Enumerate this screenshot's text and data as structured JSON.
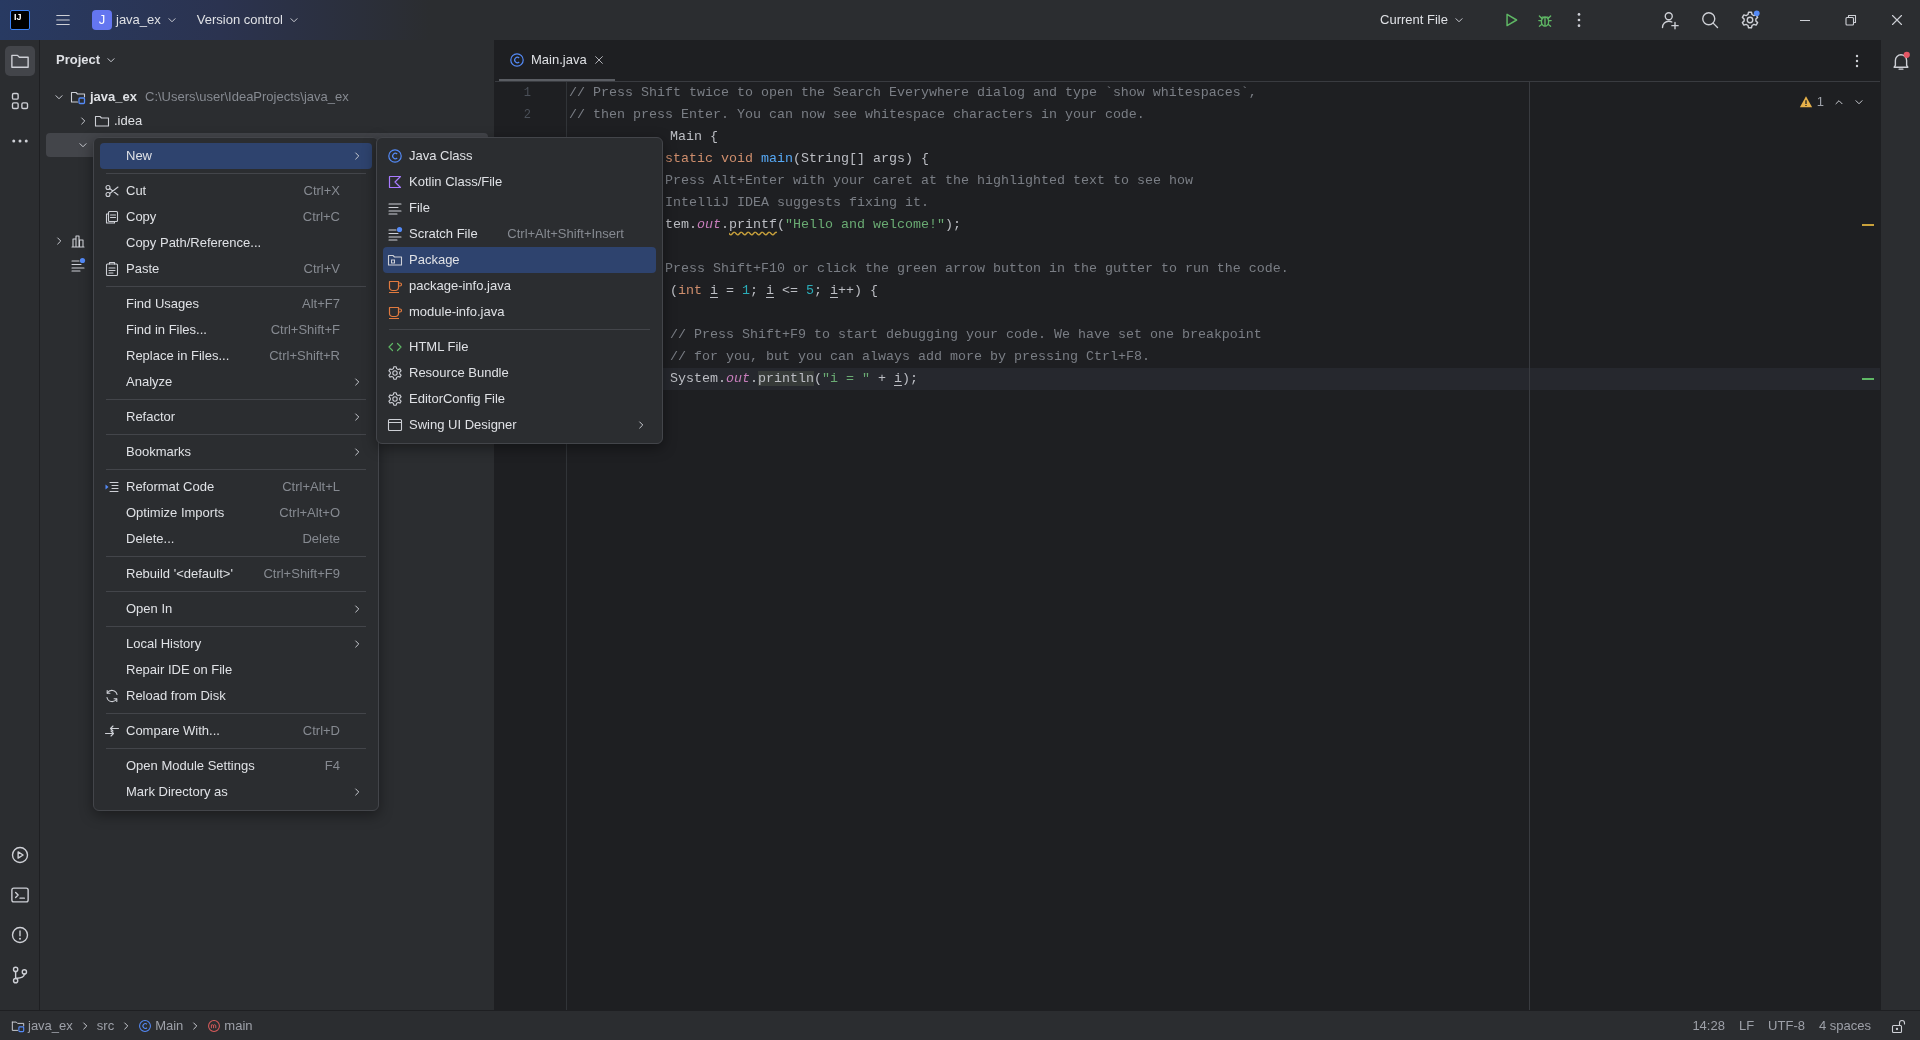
{
  "title_bar": {
    "logo": "IJ",
    "project_badge": "J",
    "project": "java_ex",
    "vcs": "Version control",
    "run_config": "Current File"
  },
  "tool_strip": {
    "top": [
      {
        "selected": true
      },
      {
        "selected": false
      },
      {
        "selected": false
      }
    ],
    "bottom": [
      {
        "selected": false
      },
      {
        "selected": false
      },
      {
        "selected": false
      },
      {
        "selected": false
      }
    ]
  },
  "project": {
    "title": "Project",
    "tree": [
      {
        "label": "java_ex",
        "path": "C:\\Users\\user\\IdeaProjects\\java_ex",
        "kind": "module",
        "expanded": true,
        "selected": false,
        "children": [
          {
            "label": ".idea",
            "kind": "folder",
            "expanded": false,
            "selected": false
          },
          {
            "expanded": true,
            "selected": true
          }
        ]
      },
      {
        "kind": "library",
        "expanded": false,
        "selected": false
      },
      {
        "kind": "scratch",
        "selected": false
      }
    ]
  },
  "tabs": [
    {
      "label": "Main.java",
      "selected": true
    }
  ],
  "editor": {
    "warnings": "1",
    "lines": [
      {
        "kind": "code",
        "number": "1",
        "current": false,
        "tokens": [
          {
            "kind": "comment",
            "text": "// Press Shift twice to open the Search Everywhere dialog and type `show whitespaces`,"
          }
        ]
      },
      {
        "kind": "code",
        "number": "2",
        "current": false,
        "tokens": [
          {
            "kind": "comment",
            "text": "// then press Enter. You can now see whitespace characters in your code."
          }
        ]
      },
      {
        "kind": "cut-deep",
        "current": false,
        "tokens": [
          {
            "kind": "plain",
            "text": "Main {"
          }
        ]
      },
      {
        "kind": "cut",
        "current": false,
        "tokens": [
          {
            "kind": "keyword",
            "text": "static void "
          },
          {
            "kind": "function",
            "text": "main"
          },
          {
            "kind": "plain",
            "text": "(String[] args) {"
          }
        ]
      },
      {
        "kind": "cut",
        "current": false,
        "tokens": [
          {
            "kind": "comment",
            "text": "Press Alt+Enter with your caret at the highlighted text to see how"
          }
        ]
      },
      {
        "kind": "cut",
        "current": false,
        "tokens": [
          {
            "kind": "comment",
            "text": "IntelliJ IDEA suggests fixing it."
          }
        ]
      },
      {
        "kind": "cut",
        "current": false,
        "color": "#c9a13b",
        "tokens": [
          {
            "kind": "plain",
            "text": "tem."
          },
          {
            "kind": "field",
            "text": "out"
          },
          {
            "kind": "plain",
            "text": "."
          },
          {
            "kind": "warning",
            "text": "printf"
          },
          {
            "kind": "plain",
            "text": "("
          },
          {
            "kind": "string",
            "text": "\"Hello and welcome!\""
          },
          {
            "kind": "plain",
            "text": ");"
          }
        ]
      },
      {
        "kind": "blank",
        "current": false
      },
      {
        "kind": "cut",
        "current": false,
        "tokens": [
          {
            "kind": "comment",
            "text": "Press Shift+F10 or click the green arrow button in the gutter to run the code."
          }
        ]
      },
      {
        "kind": "cut-deep",
        "current": false,
        "tokens": [
          {
            "kind": "plain",
            "text": "("
          },
          {
            "kind": "keyword",
            "text": "int "
          },
          {
            "kind": "variable",
            "text": "i"
          },
          {
            "kind": "plain",
            "text": " = "
          },
          {
            "kind": "number",
            "text": "1"
          },
          {
            "kind": "plain",
            "text": "; "
          },
          {
            "kind": "variable",
            "text": "i"
          },
          {
            "kind": "plain",
            "text": " <= "
          },
          {
            "kind": "number",
            "text": "5"
          },
          {
            "kind": "plain",
            "text": "; "
          },
          {
            "kind": "variable",
            "text": "i"
          },
          {
            "kind": "plain",
            "text": "++) {"
          }
        ]
      },
      {
        "kind": "blank",
        "current": false
      },
      {
        "kind": "cut-deep",
        "current": false,
        "tokens": [
          {
            "kind": "comment",
            "text": "// Press Shift+F9 to start debugging your code. We have set one breakpoint"
          }
        ]
      },
      {
        "kind": "cut-deep",
        "current": false,
        "tokens": [
          {
            "kind": "comment",
            "text": "// for you, but you can always add more by pressing Ctrl+F8."
          }
        ]
      },
      {
        "kind": "cut-deep",
        "current": true,
        "color": "#5fb865",
        "tokens": [
          {
            "kind": "plain",
            "text": "System."
          },
          {
            "kind": "field",
            "text": "out"
          },
          {
            "kind": "plain",
            "text": "."
          },
          {
            "kind": "highlighted",
            "text": "println"
          },
          {
            "kind": "plain",
            "text": "("
          },
          {
            "kind": "string",
            "text": "\"i = \""
          },
          {
            "kind": "plain",
            "text": " + "
          },
          {
            "kind": "variable",
            "text": "i"
          },
          {
            "kind": "plain",
            "text": ");"
          }
        ]
      }
    ]
  },
  "context_menu": {
    "items": [
      {
        "kind": "item",
        "label": "New",
        "submenu": true,
        "selected": true
      },
      {
        "kind": "separator"
      },
      {
        "kind": "item",
        "label": "Cut",
        "shortcut": "Ctrl+X",
        "submenu": false,
        "selected": false
      },
      {
        "kind": "item",
        "label": "Copy",
        "shortcut": "Ctrl+C",
        "submenu": false,
        "selected": false
      },
      {
        "kind": "item",
        "label": "Copy Path/Reference...",
        "submenu": false,
        "selected": false
      },
      {
        "kind": "item",
        "label": "Paste",
        "shortcut": "Ctrl+V",
        "submenu": false,
        "selected": false
      },
      {
        "kind": "separator"
      },
      {
        "kind": "item",
        "label": "Find Usages",
        "shortcut": "Alt+F7",
        "submenu": false,
        "selected": false
      },
      {
        "kind": "item",
        "label": "Find in Files...",
        "shortcut": "Ctrl+Shift+F",
        "submenu": false,
        "selected": false
      },
      {
        "kind": "item",
        "label": "Replace in Files...",
        "shortcut": "Ctrl+Shift+R",
        "submenu": false,
        "selected": false
      },
      {
        "kind": "item",
        "label": "Analyze",
        "submenu": true,
        "selected": false
      },
      {
        "kind": "separator"
      },
      {
        "kind": "item",
        "label": "Refactor",
        "submenu": true,
        "selected": false
      },
      {
        "kind": "separator"
      },
      {
        "kind": "item",
        "label": "Bookmarks",
        "submenu": true,
        "selected": false
      },
      {
        "kind": "separator"
      },
      {
        "kind": "item",
        "label": "Reformat Code",
        "shortcut": "Ctrl+Alt+L",
        "submenu": false,
        "selected": false
      },
      {
        "kind": "item",
        "label": "Optimize Imports",
        "shortcut": "Ctrl+Alt+O",
        "submenu": false,
        "selected": false
      },
      {
        "kind": "item",
        "label": "Delete...",
        "shortcut": "Delete",
        "submenu": false,
        "selected": false
      },
      {
        "kind": "separator"
      },
      {
        "kind": "item",
        "label": "Rebuild '<default>'",
        "shortcut": "Ctrl+Shift+F9",
        "submenu": false,
        "selected": false
      },
      {
        "kind": "separator"
      },
      {
        "kind": "item",
        "label": "Open In",
        "submenu": true,
        "selected": false
      },
      {
        "kind": "separator"
      },
      {
        "kind": "item",
        "label": "Local History",
        "submenu": true,
        "selected": false
      },
      {
        "kind": "item",
        "label": "Repair IDE on File",
        "submenu": false,
        "selected": false
      },
      {
        "kind": "item",
        "label": "Reload from Disk",
        "submenu": false,
        "selected": false
      },
      {
        "kind": "separator"
      },
      {
        "kind": "item",
        "label": "Compare With...",
        "shortcut": "Ctrl+D",
        "submenu": false,
        "selected": false
      },
      {
        "kind": "separator"
      },
      {
        "kind": "item",
        "label": "Open Module Settings",
        "shortcut": "F4",
        "submenu": false,
        "selected": false
      },
      {
        "kind": "item",
        "label": "Mark Directory as",
        "submenu": true,
        "selected": false
      }
    ]
  },
  "submenu": {
    "items": [
      {
        "kind": "item",
        "label": "Java Class",
        "submenu": false,
        "selected": false
      },
      {
        "kind": "item",
        "label": "Kotlin Class/File",
        "submenu": false,
        "selected": false
      },
      {
        "kind": "item",
        "label": "File",
        "submenu": false,
        "selected": false
      },
      {
        "kind": "item",
        "label": "Scratch File",
        "shortcut": "Ctrl+Alt+Shift+Insert",
        "submenu": false,
        "selected": false
      },
      {
        "kind": "item",
        "label": "Package",
        "submenu": false,
        "selected": true
      },
      {
        "kind": "item",
        "label": "package-info.java",
        "submenu": false,
        "selected": false
      },
      {
        "kind": "item",
        "label": "module-info.java",
        "submenu": false,
        "selected": false
      },
      {
        "kind": "separator"
      },
      {
        "kind": "item",
        "label": "HTML File",
        "submenu": false,
        "selected": false
      },
      {
        "kind": "item",
        "label": "Resource Bundle",
        "submenu": false,
        "selected": false
      },
      {
        "kind": "item",
        "label": "EditorConfig File",
        "submenu": false,
        "selected": false
      },
      {
        "kind": "item",
        "label": "Swing UI Designer",
        "submenu": true,
        "selected": false
      }
    ]
  },
  "status_bar": {
    "breadcrumbs": [
      {
        "label": "java_ex"
      },
      {
        "label": "src"
      },
      {
        "label": "Main"
      },
      {
        "label": "main"
      }
    ],
    "position": "14:28",
    "line_ending": "LF",
    "encoding": "UTF-8",
    "indent": "4 spaces"
  }
}
